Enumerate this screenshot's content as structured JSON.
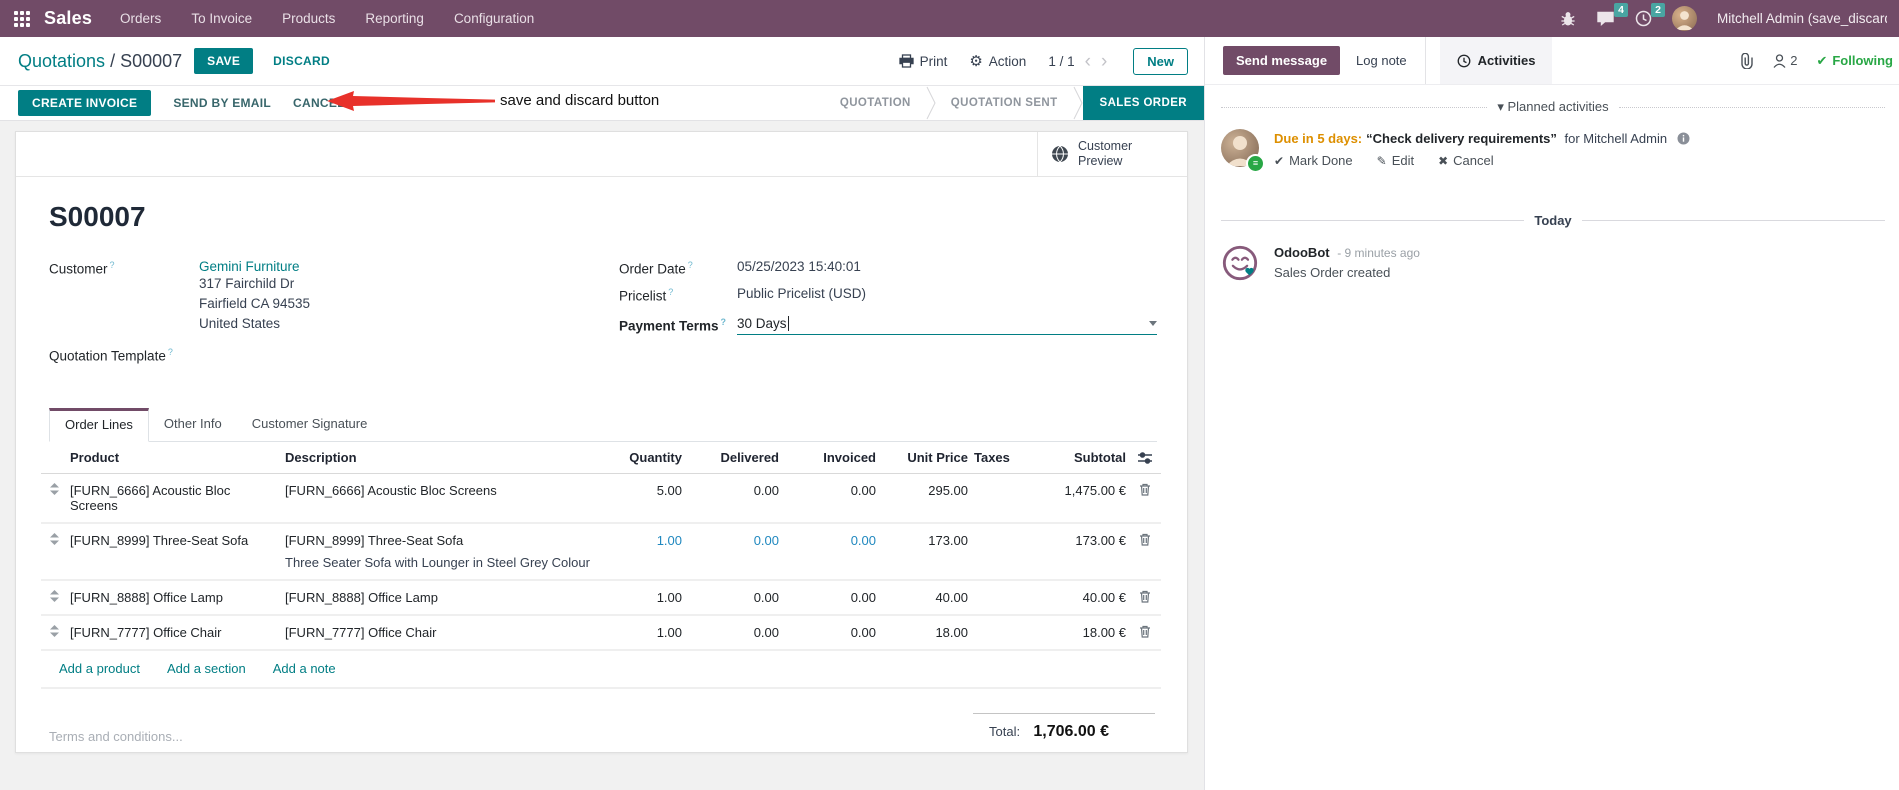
{
  "colors": {
    "brand_purple": "#714B67",
    "accent_teal": "#017E84",
    "badge_teal": "#49A5A2",
    "highlight_blue": "#2088BF",
    "due_orange": "#DD8F00",
    "success_green": "#28A745",
    "annotation_red": "#E8312A"
  },
  "navbar": {
    "app": "Sales",
    "menus": [
      "Orders",
      "To Invoice",
      "Products",
      "Reporting",
      "Configuration"
    ],
    "messages_count": "4",
    "activities_count": "2",
    "user": "Mitchell Admin (save_discard"
  },
  "control_panel": {
    "breadcrumb_parent": "Quotations",
    "breadcrumb_sep": "/",
    "breadcrumb_current": "S00007",
    "save": "SAVE",
    "discard": "DISCARD",
    "annotation": "save and discard button",
    "print": "Print",
    "action": "Action",
    "pager": "1 / 1",
    "prev": "‹",
    "next": "›",
    "new": "New"
  },
  "statusbar": {
    "buttons": [
      "CREATE INVOICE",
      "SEND BY EMAIL",
      "CANCEL"
    ],
    "states": [
      "QUOTATION",
      "QUOTATION SENT",
      "SALES ORDER"
    ],
    "active_state": "SALES ORDER"
  },
  "sheet": {
    "customer_preview": "Customer Preview",
    "title": "S00007",
    "customer_label": "Customer",
    "customer_name": "Gemini Furniture",
    "address": [
      "317 Fairchild Dr",
      "Fairfield CA 94535",
      "United States"
    ],
    "quotation_template_label": "Quotation Template",
    "order_date_label": "Order Date",
    "order_date": "05/25/2023 15:40:01",
    "pricelist_label": "Pricelist",
    "pricelist": "Public Pricelist (USD)",
    "payment_terms_label": "Payment Terms",
    "payment_terms": "30 Days",
    "tabs": [
      "Order Lines",
      "Other Info",
      "Customer Signature"
    ],
    "table": {
      "headers": {
        "product": "Product",
        "description": "Description",
        "quantity": "Quantity",
        "delivered": "Delivered",
        "invoiced": "Invoiced",
        "unit_price": "Unit Price",
        "taxes": "Taxes",
        "subtotal": "Subtotal"
      },
      "rows": [
        {
          "product": "[FURN_6666] Acoustic Bloc Screens",
          "description": "[FURN_6666] Acoustic Bloc Screens",
          "description2": "",
          "quantity": "5.00",
          "delivered": "0.00",
          "invoiced": "0.00",
          "unit_price": "295.00",
          "taxes": "",
          "subtotal": "1,475.00 €"
        },
        {
          "product": "[FURN_8999] Three-Seat Sofa",
          "description": "[FURN_8999] Three-Seat Sofa",
          "description2": "Three Seater Sofa with Lounger in Steel Grey Colour",
          "quantity": "1.00",
          "delivered": "0.00",
          "invoiced": "0.00",
          "unit_price": "173.00",
          "taxes": "",
          "subtotal": "173.00 €"
        },
        {
          "product": "[FURN_8888] Office Lamp",
          "description": "[FURN_8888] Office Lamp",
          "description2": "",
          "quantity": "1.00",
          "delivered": "0.00",
          "invoiced": "0.00",
          "unit_price": "40.00",
          "taxes": "",
          "subtotal": "40.00 €"
        },
        {
          "product": "[FURN_7777] Office Chair",
          "description": "[FURN_7777] Office Chair",
          "description2": "",
          "quantity": "1.00",
          "delivered": "0.00",
          "invoiced": "0.00",
          "unit_price": "18.00",
          "taxes": "",
          "subtotal": "18.00 €"
        }
      ],
      "links": [
        "Add a product",
        "Add a section",
        "Add a note"
      ]
    },
    "terms_placeholder": "Terms and conditions...",
    "total_label": "Total:",
    "total_value": "1,706.00 €"
  },
  "chatter": {
    "send_message": "Send message",
    "log_note": "Log note",
    "activities": "Activities",
    "followers_count": "2",
    "following": "Following",
    "planned_header": "Planned activities",
    "activity": {
      "due": "Due in 5 days:",
      "summary": "“Check delivery requirements”",
      "for_user": "for Mitchell Admin",
      "mark_done": "Mark Done",
      "edit": "Edit",
      "cancel": "Cancel"
    },
    "today": "Today",
    "message": {
      "author": "OdooBot",
      "time": "- 9 minutes ago",
      "body": "Sales Order created"
    }
  }
}
